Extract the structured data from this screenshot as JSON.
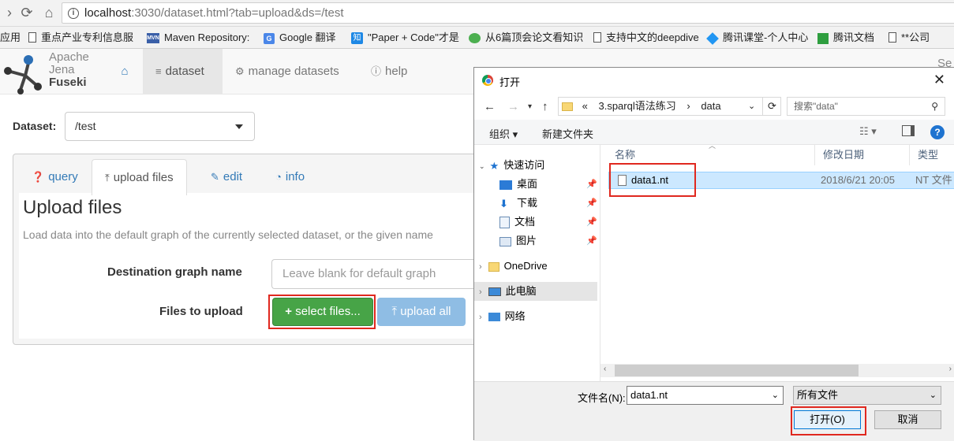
{
  "browser": {
    "url_host": "localhost",
    "url_rest": ":3030/dataset.html?tab=upload&ds=/test",
    "bookmarks": [
      {
        "label": "应用",
        "icon": "apps-icon"
      },
      {
        "label": "重点产业专利信息服",
        "icon": "page-icon"
      },
      {
        "label": "Maven Repository:",
        "icon": "maven-icon"
      },
      {
        "label": "Google 翻译",
        "icon": "google-translate-icon"
      },
      {
        "label": "\"Paper + Code\"才是",
        "icon": "zhihu-icon"
      },
      {
        "label": "从6篇顶会论文看知识",
        "icon": "wechat-icon"
      },
      {
        "label": "支持中文的deepdive",
        "icon": "page-icon"
      },
      {
        "label": "腾讯课堂-个人中心",
        "icon": "tencent-icon"
      },
      {
        "label": "腾讯文档",
        "icon": "tencent-docs-icon"
      },
      {
        "label": "**公司",
        "icon": "page-icon"
      }
    ]
  },
  "fuseki": {
    "logo": {
      "line1": "Apache",
      "line2": "Jena",
      "line3": "Fuseki"
    },
    "nav": [
      {
        "label": "",
        "icon": "home-icon"
      },
      {
        "label": "dataset",
        "icon": "database-icon"
      },
      {
        "label": "manage datasets",
        "icon": "cogs-icon"
      },
      {
        "label": "help",
        "icon": "info-circle-icon"
      }
    ],
    "right_cut_text": "Se",
    "dataset_label": "Dataset:",
    "dataset_value": "/test",
    "tabs": [
      {
        "label": "query",
        "icon": "question-circle-icon"
      },
      {
        "label": "upload files",
        "icon": "upload-icon"
      },
      {
        "label": "edit",
        "icon": "edit-icon"
      },
      {
        "label": "info",
        "icon": "dashboard-icon"
      }
    ],
    "upload": {
      "title": "Upload files",
      "description": "Load data into the default graph of the currently selected dataset, or the given name",
      "dest_label": "Destination graph name",
      "dest_placeholder": "Leave blank for default graph",
      "files_label": "Files to upload",
      "select_button": "select files...",
      "upload_button": "upload all"
    }
  },
  "dialog": {
    "title": "打开",
    "path": [
      "«",
      "3.sparql语法练习",
      "›",
      "data"
    ],
    "search_placeholder": "搜索\"data\"",
    "organize": "组织 ▾",
    "new_folder": "新建文件夹",
    "tree": [
      {
        "label": "快速访问",
        "icon": "star-icon"
      },
      {
        "label": "桌面",
        "icon": "desktop-icon"
      },
      {
        "label": "下载",
        "icon": "download-icon"
      },
      {
        "label": "文档",
        "icon": "documents-icon"
      },
      {
        "label": "图片",
        "icon": "pictures-icon"
      },
      {
        "label": "OneDrive",
        "icon": "folder-icon"
      },
      {
        "label": "此电脑",
        "icon": "computer-icon"
      },
      {
        "label": "网络",
        "icon": "network-icon"
      }
    ],
    "columns": {
      "name": "名称",
      "date": "修改日期",
      "type": "类型"
    },
    "files": [
      {
        "name": "data1.nt",
        "date": "2018/6/21 20:05",
        "type": "NT 文件"
      }
    ],
    "filename_label": "文件名(N):",
    "filename_value": "data1.nt",
    "filetype_value": "所有文件",
    "open_button": "打开(O)",
    "cancel_button": "取消"
  },
  "colors": {
    "accent_link": "#337ab7",
    "success": "#47a447",
    "highlight": "#e0281f"
  }
}
